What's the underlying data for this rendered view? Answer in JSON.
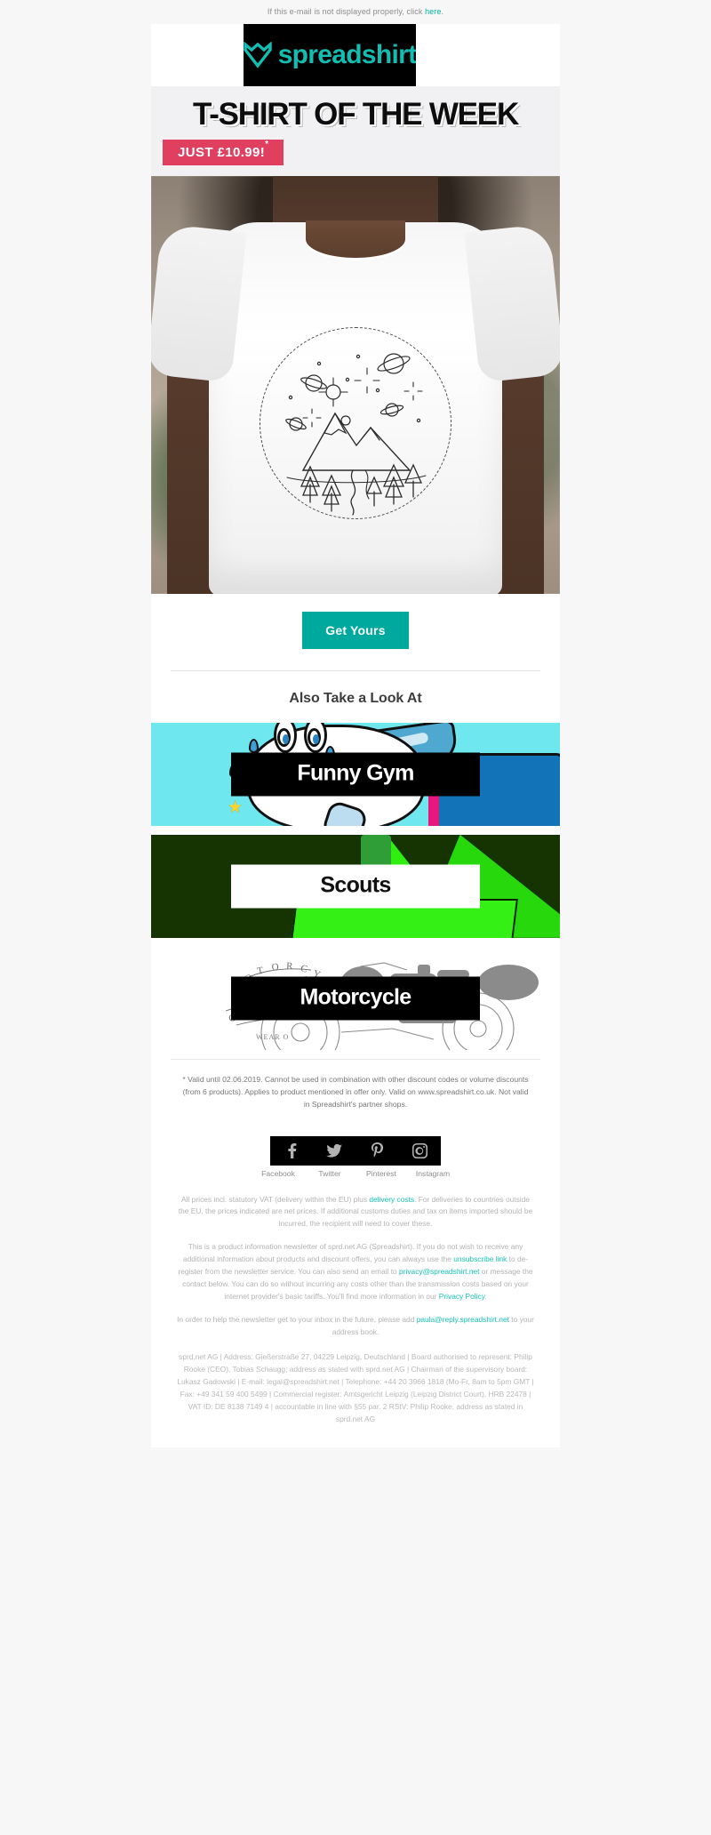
{
  "preheader": {
    "text_before": "If this e-mail is not displayed properly, click ",
    "link": "here",
    "text_after": "."
  },
  "brand": {
    "name": "spreadshirt",
    "logo_icon": "spreadshirt-heart-icon",
    "colors": {
      "teal": "#12bdb2",
      "black": "#000000",
      "pink": "#e03f60",
      "cta": "#00a99d"
    }
  },
  "hero": {
    "headline": "T-SHIRT OF THE WEEK",
    "price_badge": "JUST £10.99!",
    "price_badge_asterisk": "*",
    "product_alt": "Man wearing white t-shirt with mountain and space line-art print",
    "cta_label": "Get Yours"
  },
  "also": {
    "title": "Also Take a Look At",
    "banners": [
      {
        "label": "Funny Gym",
        "label_style": "dark",
        "bg": "#6fe7ef"
      },
      {
        "label": "Scouts",
        "label_style": "light",
        "bg": "#153401"
      },
      {
        "label": "Motorcycle",
        "label_style": "dark",
        "bg": "#ffffff"
      }
    ]
  },
  "fineprint": "* Valid until 02.06.2019. Cannot be used in combination with other discount codes or volume discounts (from 6 products). Applies to product mentioned in offer only. Valid on www.spreadshirt.co.uk. Not valid in Spreadshirt's partner shops.",
  "social": {
    "items": [
      {
        "icon": "facebook-icon",
        "label": "Facebook"
      },
      {
        "icon": "twitter-icon",
        "label": "Twitter"
      },
      {
        "icon": "pinterest-icon",
        "label": "Pinterest"
      },
      {
        "icon": "instagram-icon",
        "label": "Instagram"
      }
    ]
  },
  "footer": {
    "vat_p1": "All prices incl. statutory VAT (delivery within the EU) plus ",
    "vat_link": "delivery costs",
    "vat_p2": ". For deliveries to countries outside the EU, the prices indicated are net prices. If additional customs duties and tax on items imported should be incurred, the recipient will need to cover these.",
    "news_p1": "This is a product information newsletter of sprd.net AG (Spreadshirt). If you do not wish to receive any additional information about products and discount offers, you can always use the ",
    "news_link1": "unsubscribe link",
    "news_p2": " to de-register from the newsletter service. You can also send an email to ",
    "news_link2": "privacy@spreadshirt.net",
    "news_p3": " or message the contact below. You can do so without incurring any costs other than the transmission costs based on your internet provider's basic tariffs. You'll find more information in our ",
    "news_link3": "Privacy Policy",
    "news_p4": ".",
    "inbox_p1": "In order to help the newsletter get to your inbox in the future, please add ",
    "inbox_link": "paula@reply.spreadshirt.net",
    "inbox_p2": " to your address book.",
    "address": "sprd.net AG | Address: Gießerstraße 27, 04229 Leipzig, Deutschland | Board authorised to represent: Philip Rooke (CEO), Tobias Schaugg; address as stated with sprd.net AG | Chairman of the supervisory board: Lukasz Gadowski | E-mail: legal@spreadshirt.net | Telephone: +44 20 3966 1818 (Mo-Fr, 8am to 5pm GMT | Fax: +49 341 59 400 5499 | Commercial register: Amtsgericht Leipzig (Leipzig District Court), HRB 22478 | VAT ID: DE 8138 7149 4 | accountable in line with §55 par. 2 RStV: Philip Rooke, address as stated in sprd.net AG"
  }
}
